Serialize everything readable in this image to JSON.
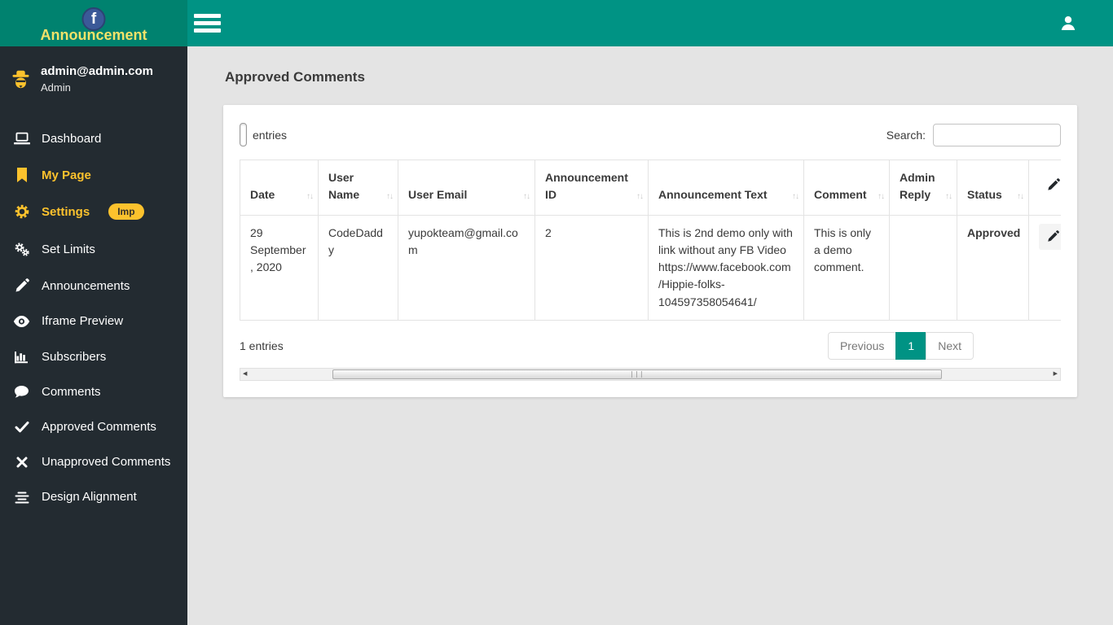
{
  "brand": {
    "title": "Announcement"
  },
  "user": {
    "email": "admin@admin.com",
    "role": "Admin"
  },
  "sidebar": {
    "items": [
      {
        "label": "Dashboard",
        "icon": "laptop-icon"
      },
      {
        "label": "My Page",
        "icon": "bookmark-icon"
      },
      {
        "label": "Settings",
        "icon": "gear-icon",
        "badge": "Imp"
      },
      {
        "label": "Set Limits",
        "icon": "cogs-icon"
      },
      {
        "label": "Announcements",
        "icon": "pencil-icon"
      },
      {
        "label": "Iframe Preview",
        "icon": "eye-icon"
      },
      {
        "label": "Subscribers",
        "icon": "bar-chart-icon"
      },
      {
        "label": "Comments",
        "icon": "comment-icon"
      },
      {
        "label": "Approved Comments",
        "icon": "check-icon"
      },
      {
        "label": "Unapproved Comments",
        "icon": "x-icon"
      },
      {
        "label": "Design Alignment",
        "icon": "align-center-icon"
      }
    ]
  },
  "page": {
    "title": "Approved Comments"
  },
  "table_card": {
    "entries_label": "entries",
    "search_label": "Search:",
    "search_value": "",
    "columns": [
      {
        "label": "Date"
      },
      {
        "label": "User Name"
      },
      {
        "label": "User Email"
      },
      {
        "label": "Announcement ID"
      },
      {
        "label": "Announcement Text"
      },
      {
        "label": "Comment"
      },
      {
        "label": "Admin Reply"
      },
      {
        "label": "Status"
      },
      {
        "label": "",
        "icon": "pencil-icon"
      }
    ],
    "rows": [
      {
        "date": "29 September, 2020",
        "user_name": "CodeDaddy",
        "user_email": "yupokteam@gmail.com",
        "announcement_id": "2",
        "announcement_text": "This is 2nd demo only with link without any FB Video https://www.facebook.com/Hippie-folks-104597358054641/",
        "comment": "This is only a demo comment.",
        "admin_reply": "",
        "status": "Approved"
      }
    ],
    "footer": {
      "info": "1 entries",
      "previous_label": "Previous",
      "current_page": "1",
      "next_label": "Next"
    }
  },
  "colors": {
    "topbar_teal": "#009384",
    "brand_teal": "#00826F",
    "sidebar_dark": "#232B31",
    "accent_yellow": "#FCC22D",
    "logo_yellow": "#F3E269",
    "facebook_blue": "#3B5998",
    "pagination_active": "#009384"
  }
}
